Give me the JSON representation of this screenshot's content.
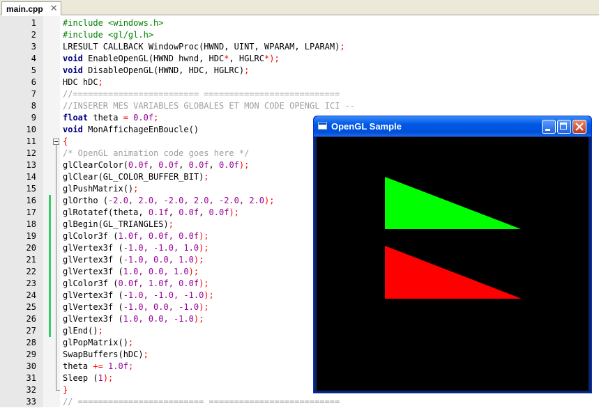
{
  "tab": {
    "label": "main.cpp",
    "close": "✕"
  },
  "editor": {
    "lines": [
      {
        "n": "1",
        "parts": [
          {
            "t": "#include <windows.h>",
            "c": "pp"
          }
        ]
      },
      {
        "n": "2",
        "parts": [
          {
            "t": "#include <gl/gl.h>",
            "c": "pp"
          }
        ]
      },
      {
        "n": "3",
        "parts": [
          {
            "t": "LRESULT CALLBACK WindowProc(HWND, UINT, WPARAM, LPARAM)",
            "c": ""
          },
          {
            "t": ";",
            "c": "op"
          }
        ]
      },
      {
        "n": "4",
        "parts": [
          {
            "t": "void",
            "c": "kw"
          },
          {
            "t": " EnableOpenGL(HWND hwnd, HDC",
            "c": ""
          },
          {
            "t": "*",
            "c": "op"
          },
          {
            "t": ", HGLRC",
            "c": ""
          },
          {
            "t": "*",
            "c": "op"
          },
          {
            "t": ");",
            "c": "op"
          }
        ]
      },
      {
        "n": "5",
        "parts": [
          {
            "t": "void",
            "c": "kw"
          },
          {
            "t": " DisableOpenGL(HWND, HDC, HGLRC)",
            "c": ""
          },
          {
            "t": ";",
            "c": "op"
          }
        ]
      },
      {
        "n": "6",
        "parts": [
          {
            "t": "HDC hDC",
            "c": ""
          },
          {
            "t": ";",
            "c": "op"
          }
        ]
      },
      {
        "n": "7",
        "parts": [
          {
            "t": "//========================= ===========================",
            "c": "cmb"
          }
        ]
      },
      {
        "n": "8",
        "parts": [
          {
            "t": "//INSERER MES VARIABLES GLOBALES ET MON CODE OPENGL ICI --",
            "c": "cmb"
          }
        ]
      },
      {
        "n": "9",
        "parts": [
          {
            "t": "float",
            "c": "kw"
          },
          {
            "t": " theta ",
            "c": ""
          },
          {
            "t": "=",
            "c": "op"
          },
          {
            "t": " 0.0f",
            "c": "mg"
          },
          {
            "t": ";",
            "c": "op"
          }
        ]
      },
      {
        "n": "10",
        "parts": [
          {
            "t": "void",
            "c": "kw"
          },
          {
            "t": " MonAffichageEnBoucle()",
            "c": ""
          }
        ]
      },
      {
        "n": "11",
        "parts": [
          {
            "t": "{",
            "c": "op"
          }
        ]
      },
      {
        "n": "12",
        "parts": [
          {
            "t": "/* OpenGL animation code goes here */",
            "c": "cmb"
          }
        ]
      },
      {
        "n": "13",
        "parts": [
          {
            "t": "glClearColor(",
            "c": ""
          },
          {
            "t": "0.0f",
            "c": "mg"
          },
          {
            "t": ", ",
            "c": ""
          },
          {
            "t": "0.0f",
            "c": "mg"
          },
          {
            "t": ", ",
            "c": ""
          },
          {
            "t": "0.0f",
            "c": "mg"
          },
          {
            "t": ", ",
            "c": ""
          },
          {
            "t": "0.0f",
            "c": "mg"
          },
          {
            "t": ");",
            "c": "op"
          }
        ]
      },
      {
        "n": "14",
        "parts": [
          {
            "t": "glClear(GL_COLOR_BUFFER_BIT)",
            "c": ""
          },
          {
            "t": ";",
            "c": "op"
          }
        ]
      },
      {
        "n": "15",
        "parts": [
          {
            "t": "glPushMatrix()",
            "c": ""
          },
          {
            "t": ";",
            "c": "op"
          }
        ]
      },
      {
        "n": "16",
        "parts": [
          {
            "t": "glOrtho (",
            "c": ""
          },
          {
            "t": "-2.0, 2.0, -2.0, 2.0, -2.0, 2.0",
            "c": "mg"
          },
          {
            "t": ");",
            "c": "op"
          }
        ]
      },
      {
        "n": "17",
        "parts": [
          {
            "t": "glRotatef(theta, ",
            "c": ""
          },
          {
            "t": "0.1f",
            "c": "mg"
          },
          {
            "t": ", ",
            "c": ""
          },
          {
            "t": "0.0f",
            "c": "mg"
          },
          {
            "t": ", ",
            "c": ""
          },
          {
            "t": "0.0f",
            "c": "mg"
          },
          {
            "t": ");",
            "c": "op"
          }
        ]
      },
      {
        "n": "18",
        "parts": [
          {
            "t": "glBegin(GL_TRIANGLES)",
            "c": ""
          },
          {
            "t": ";",
            "c": "op"
          }
        ]
      },
      {
        "n": "19",
        "parts": [
          {
            "t": "glColor3f (",
            "c": ""
          },
          {
            "t": "1.0f, 0.0f, 0.0f",
            "c": "mg"
          },
          {
            "t": ");",
            "c": "op"
          }
        ]
      },
      {
        "n": "20",
        "parts": [
          {
            "t": "glVertex3f (",
            "c": ""
          },
          {
            "t": "-1.0, -1.0, 1.0",
            "c": "mg"
          },
          {
            "t": ");",
            "c": "op"
          }
        ]
      },
      {
        "n": "21",
        "parts": [
          {
            "t": "glVertex3f (",
            "c": ""
          },
          {
            "t": "-1.0, 0.0, 1.0",
            "c": "mg"
          },
          {
            "t": ");",
            "c": "op"
          }
        ]
      },
      {
        "n": "22",
        "parts": [
          {
            "t": "glVertex3f (",
            "c": ""
          },
          {
            "t": "1.0, 0.0, 1.0",
            "c": "mg"
          },
          {
            "t": ");",
            "c": "op"
          }
        ]
      },
      {
        "n": "23",
        "parts": [
          {
            "t": "glColor3f (",
            "c": ""
          },
          {
            "t": "0.0f, 1.0f, 0.0f",
            "c": "mg"
          },
          {
            "t": ");",
            "c": "op"
          }
        ]
      },
      {
        "n": "24",
        "parts": [
          {
            "t": "glVertex3f (",
            "c": ""
          },
          {
            "t": "-1.0, -1.0, -1.0",
            "c": "mg"
          },
          {
            "t": ");",
            "c": "op"
          }
        ]
      },
      {
        "n": "25",
        "parts": [
          {
            "t": "glVertex3f (",
            "c": ""
          },
          {
            "t": "-1.0, 0.0, -1.0",
            "c": "mg"
          },
          {
            "t": ");",
            "c": "op"
          }
        ]
      },
      {
        "n": "26",
        "parts": [
          {
            "t": "glVertex3f (",
            "c": ""
          },
          {
            "t": "1.0, 0.0, -1.0",
            "c": "mg"
          },
          {
            "t": ");",
            "c": "op"
          }
        ]
      },
      {
        "n": "27",
        "parts": [
          {
            "t": "glEnd()",
            "c": ""
          },
          {
            "t": ";",
            "c": "op"
          }
        ]
      },
      {
        "n": "28",
        "parts": [
          {
            "t": "glPopMatrix()",
            "c": ""
          },
          {
            "t": ";",
            "c": "op"
          }
        ]
      },
      {
        "n": "29",
        "parts": [
          {
            "t": "SwapBuffers(hDC)",
            "c": ""
          },
          {
            "t": ";",
            "c": "op"
          }
        ]
      },
      {
        "n": "30",
        "parts": [
          {
            "t": "theta ",
            "c": ""
          },
          {
            "t": "+=",
            "c": "op"
          },
          {
            "t": " 1.0f",
            "c": "mg"
          },
          {
            "t": ";",
            "c": "op"
          }
        ]
      },
      {
        "n": "31",
        "parts": [
          {
            "t": "Sleep (",
            "c": ""
          },
          {
            "t": "1",
            "c": "mg"
          },
          {
            "t": ");",
            "c": "op"
          }
        ]
      },
      {
        "n": "32",
        "parts": [
          {
            "t": "}",
            "c": "op"
          }
        ]
      },
      {
        "n": "33",
        "parts": [
          {
            "t": "// ========================= ==========================",
            "c": "cmb"
          }
        ]
      }
    ],
    "changed_lines": [
      "16",
      "17",
      "18",
      "19",
      "20",
      "21",
      "22",
      "23",
      "24",
      "25",
      "26",
      "27"
    ]
  },
  "gl_window": {
    "title": "OpenGL Sample",
    "background": "#000000",
    "triangle_colors": {
      "green": "#00ff00",
      "red": "#ff0000"
    }
  }
}
